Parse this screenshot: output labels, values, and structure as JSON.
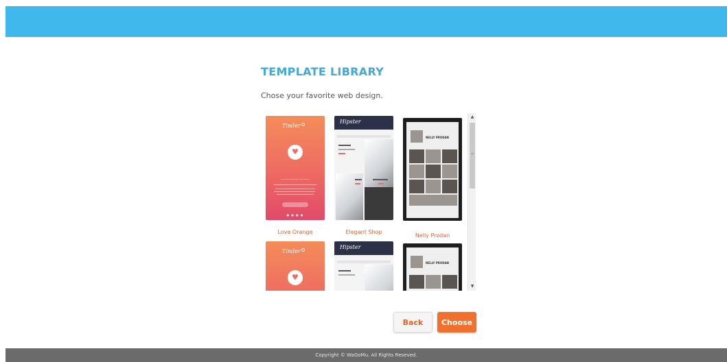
{
  "header": {
    "color": "#41b8ec"
  },
  "main": {
    "title": "TEMPLATE LIBRARY",
    "subtitle": "Chose your favorite web design."
  },
  "templates": [
    {
      "name": "Love Orange",
      "brand": "Tinder"
    },
    {
      "name": "Elegant Shop",
      "brand": "Hipster"
    },
    {
      "name": "Nelly Prodan",
      "brand": "NELLY PRODAN"
    }
  ],
  "actions": {
    "back_label": "Back",
    "choose_label": "Choose",
    "accent": "#f0702e"
  },
  "footer": {
    "copyright": "Copyright © WaGoMu. All Rights Reseved."
  },
  "icons": {
    "scroll_up": "triangle-up-icon",
    "scroll_down": "triangle-down-icon",
    "heart": "heart-icon"
  }
}
